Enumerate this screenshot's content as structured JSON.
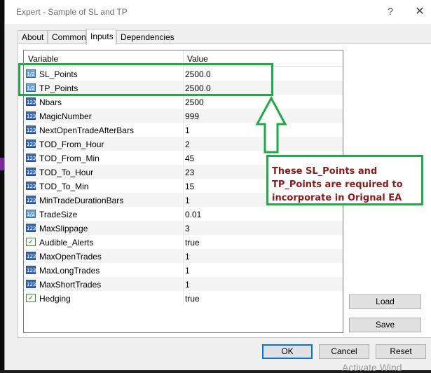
{
  "window": {
    "title": "Expert - Sample of SL and TP",
    "help_glyph": "?",
    "close_glyph": "✕"
  },
  "tabs": [
    {
      "label": "About"
    },
    {
      "label": "Common"
    },
    {
      "label": "Inputs"
    },
    {
      "label": "Dependencies"
    }
  ],
  "grid": {
    "col_variable": "Variable",
    "col_value": "Value",
    "rows": [
      {
        "name": "SL_Points",
        "value": "2500.0",
        "type": "dbl",
        "icon": "1/2"
      },
      {
        "name": "TP_Points",
        "value": "2500.0",
        "type": "dbl",
        "icon": "1/2"
      },
      {
        "name": "Nbars",
        "value": "2500",
        "type": "int",
        "icon": "123"
      },
      {
        "name": "MagicNumber",
        "value": "999",
        "type": "int",
        "icon": "123"
      },
      {
        "name": "NextOpenTradeAfterBars",
        "value": "1",
        "type": "int",
        "icon": "123"
      },
      {
        "name": "TOD_From_Hour",
        "value": "2",
        "type": "int",
        "icon": "123"
      },
      {
        "name": "TOD_From_Min",
        "value": "45",
        "type": "int",
        "icon": "123"
      },
      {
        "name": "TOD_To_Hour",
        "value": "23",
        "type": "int",
        "icon": "123"
      },
      {
        "name": "TOD_To_Min",
        "value": "15",
        "type": "int",
        "icon": "123"
      },
      {
        "name": "MinTradeDurationBars",
        "value": "1",
        "type": "int",
        "icon": "123"
      },
      {
        "name": "TradeSize",
        "value": "0.01",
        "type": "dbl",
        "icon": "1/2"
      },
      {
        "name": "MaxSlippage",
        "value": "3",
        "type": "int",
        "icon": "123"
      },
      {
        "name": "Audible_Alerts",
        "value": "true",
        "type": "bool",
        "icon": "✓"
      },
      {
        "name": "MaxOpenTrades",
        "value": "1",
        "type": "int",
        "icon": "123"
      },
      {
        "name": "MaxLongTrades",
        "value": "1",
        "type": "int",
        "icon": "123"
      },
      {
        "name": "MaxShortTrades",
        "value": "1",
        "type": "int",
        "icon": "123"
      },
      {
        "name": "Hedging",
        "value": "true",
        "type": "bool",
        "icon": "✓"
      }
    ]
  },
  "side_buttons": {
    "load": "Load",
    "save": "Save"
  },
  "footer": {
    "ok": "OK",
    "cancel": "Cancel",
    "reset": "Reset"
  },
  "annotation": {
    "text": "These SL_Points and TP_Points are required to incorporate in Orignal EA",
    "color": "#8b1a1a",
    "border_color": "#22a84a"
  },
  "watermark": "Activate Wind"
}
